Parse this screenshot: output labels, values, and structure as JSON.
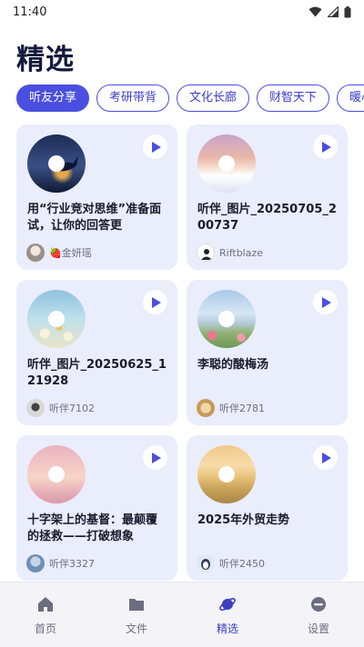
{
  "status_bar": {
    "time": "11:40"
  },
  "page": {
    "title": "精选"
  },
  "tabs": [
    {
      "label": "听友分享",
      "active": true
    },
    {
      "label": "考研带背",
      "active": false
    },
    {
      "label": "文化长廊",
      "active": false
    },
    {
      "label": "财智天下",
      "active": false
    },
    {
      "label": "暖心·",
      "active": false
    }
  ],
  "cards": [
    {
      "title": "用“行业竞对思维”准备面试，让你的回答更",
      "author": "🍓金妍瑶",
      "cover": "whale-night",
      "play_icon": "play-icon"
    },
    {
      "title": "听伴_图片_20250705_200737",
      "author": "Riftblaze",
      "cover": "snow-sunset",
      "play_icon": "play-icon"
    },
    {
      "title": "听伴_图片_20250625_121928",
      "author": "听伴7102",
      "cover": "daisies-sky",
      "play_icon": "play-icon"
    },
    {
      "title": "李聪的酸梅汤",
      "author": "听伴2781",
      "cover": "flower-field",
      "play_icon": "play-icon"
    },
    {
      "title": "十字架上的基督：最颠覆的拯救——打破想象",
      "author": "听伴3327",
      "cover": "pink-clouds",
      "play_icon": "play-icon"
    },
    {
      "title": "2025年外贸走势",
      "author": "听伴2450",
      "cover": "golden-hills",
      "play_icon": "play-icon"
    }
  ],
  "bottom_nav": [
    {
      "label": "首页",
      "icon": "home-icon",
      "active": false
    },
    {
      "label": "文件",
      "icon": "folder-icon",
      "active": false
    },
    {
      "label": "精选",
      "icon": "planet-icon",
      "active": true
    },
    {
      "label": "设置",
      "icon": "settings-icon",
      "active": false
    }
  ],
  "colors": {
    "accent": "#4a4fe0",
    "card_bg": "#eaedfb",
    "nav_bg": "#f3f3f8"
  }
}
